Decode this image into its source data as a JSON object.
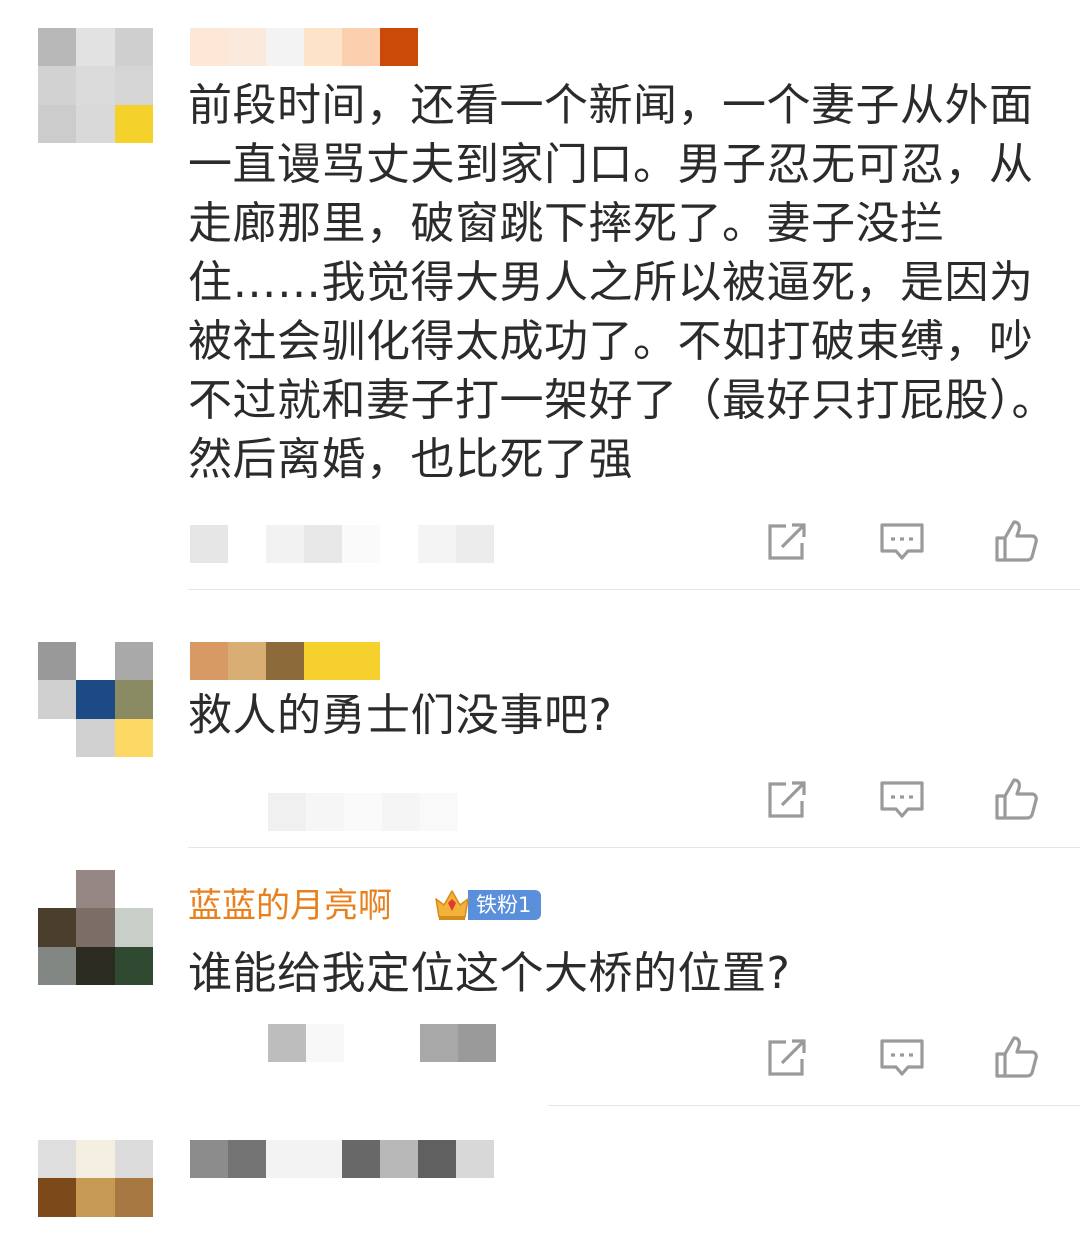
{
  "comments": [
    {
      "text": "前段时间，还看一个新闻，一个妻子从外面一直谩骂丈夫到家门口。男子忍无可忍，从走廊那里，破窗跳下摔死了。妻子没拦住……我觉得大男人之所以被逼死，是因为被社会驯化得太成功了。不如打破束缚，吵不过就和妻子打一架好了（最好只打屁股）。然后离婚，也比死了强",
      "avatar_colors": [
        "#b8b8b8",
        "#e2e2e2",
        "#cfcfcf",
        "#d2d2d2",
        "#dbdbdb",
        "#d5d5d5",
        "#cccccc",
        "#d9d9d9",
        "#f4d12b"
      ],
      "name_colors": [
        "#fde7d6",
        "#fbe9dc",
        "#f3f3f3",
        "#fde3c8",
        "#fcd0ae",
        "#cc4a08"
      ]
    },
    {
      "text": "救人的勇士们没事吧?",
      "avatar_colors": [
        "#999999",
        "#ffffff",
        "#a9a9a9",
        "#d0d0d0",
        "#1c4a84",
        "#8b8b63",
        "#ffffff",
        "#d1d1d1",
        "#fbd964"
      ],
      "name_colors": [
        "#d79a64",
        "#d9ae74",
        "#8c6a3a",
        "#f6d02c",
        "#f6d02c"
      ]
    },
    {
      "username": "蓝蓝的月亮啊",
      "badge": "铁粉1",
      "text": "谁能给我定位这个大桥的位置?",
      "avatar_colors": [
        "#ffffff",
        "#948784",
        "#ffffff",
        "#4a3f2c",
        "#7b6e66",
        "#c8cfc8",
        "#838783",
        "#2b2b22",
        "#2f4a30"
      ]
    },
    {
      "avatar_colors": [
        "#dedede",
        "#f4efe0",
        "#dcdcdc",
        "#7c4a1a",
        "#c79a54",
        "#a87842",
        "#ffffff",
        "#ffffff",
        "#ffffff"
      ],
      "name_colors": [
        "#8c8c8c",
        "#747474",
        "#f3f3f3",
        "#f3f3f3",
        "#686868",
        "#b8b8b8",
        "#606060",
        "#d8d8d8"
      ]
    }
  ],
  "icons": {
    "share": "share-icon",
    "comment": "comment-icon",
    "like": "thumbs-up-icon"
  },
  "colors": {
    "username": "#e8801e",
    "badge": "#5a8fdc",
    "icon_stroke": "#9a9a9a"
  }
}
